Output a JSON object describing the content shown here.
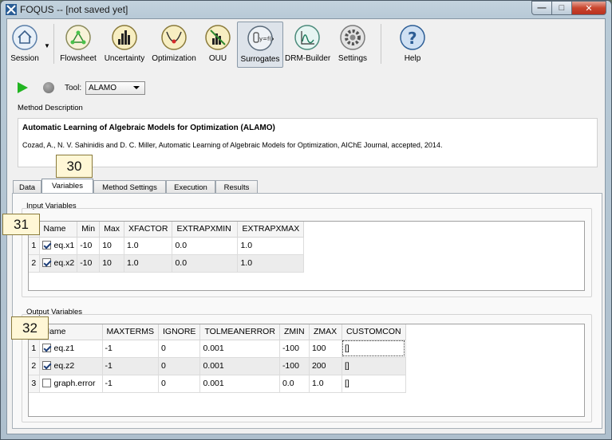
{
  "window": {
    "title": "FOQUS -- [not saved yet]"
  },
  "toolbar": {
    "session": "Session",
    "flowsheet": "Flowsheet",
    "uncertainty": "Uncertainty",
    "optimization": "Optimization",
    "ouu": "OUU",
    "surrogates": "Surrogates",
    "drm_builder": "DRM-Builder",
    "settings": "Settings",
    "help": "Help"
  },
  "run": {
    "tool_label": "Tool:",
    "tool_value": "ALAMO"
  },
  "method": {
    "label": "Method Description",
    "title": "Automatic Learning of Algebraic Models for Optimization (ALAMO)",
    "citation": "Cozad, A., N. V. Sahinidis and D. C. Miller, Automatic Learning of Algebraic Models for Optimization, AIChE Journal, accepted, 2014."
  },
  "tabs": [
    "Data",
    "Variables",
    "Method Settings",
    "Execution",
    "Results"
  ],
  "active_tab": "Variables",
  "markers": {
    "m30": "30",
    "m31": "31",
    "m32": "32"
  },
  "input_vars": {
    "label": "Input Variables",
    "columns": [
      "Name",
      "Min",
      "Max",
      "XFACTOR",
      "EXTRAPXMIN",
      "EXTRAPXMAX"
    ],
    "rows": [
      {
        "num": "1",
        "checked": true,
        "name": "eq.x1",
        "min": "-10",
        "max": "10",
        "xfactor": "1.0",
        "extrapxmin": "0.0",
        "extrapxmax": "1.0"
      },
      {
        "num": "2",
        "checked": true,
        "name": "eq.x2",
        "min": "-10",
        "max": "10",
        "xfactor": "1.0",
        "extrapxmin": "0.0",
        "extrapxmax": "1.0"
      }
    ]
  },
  "output_vars": {
    "label": "Output Variables",
    "columns": [
      "Name",
      "MAXTERMS",
      "IGNORE",
      "TOLMEANERROR",
      "ZMIN",
      "ZMAX",
      "CUSTOMCON"
    ],
    "rows": [
      {
        "num": "1",
        "checked": true,
        "name": "eq.z1",
        "maxterms": "-1",
        "ignore": "0",
        "tolmeanerror": "0.001",
        "zmin": "-100",
        "zmax": "100",
        "customcon": "[]"
      },
      {
        "num": "2",
        "checked": true,
        "name": "eq.z2",
        "maxterms": "-1",
        "ignore": "0",
        "tolmeanerror": "0.001",
        "zmin": "-100",
        "zmax": "200",
        "customcon": "[]"
      },
      {
        "num": "3",
        "checked": false,
        "name": "graph.error",
        "maxterms": "-1",
        "ignore": "0",
        "tolmeanerror": "0.001",
        "zmin": "0.0",
        "zmax": "1.0",
        "customcon": "[]"
      }
    ]
  },
  "colors": {
    "accent_play": "#22b522",
    "marker_bg": "#fff7d6"
  }
}
